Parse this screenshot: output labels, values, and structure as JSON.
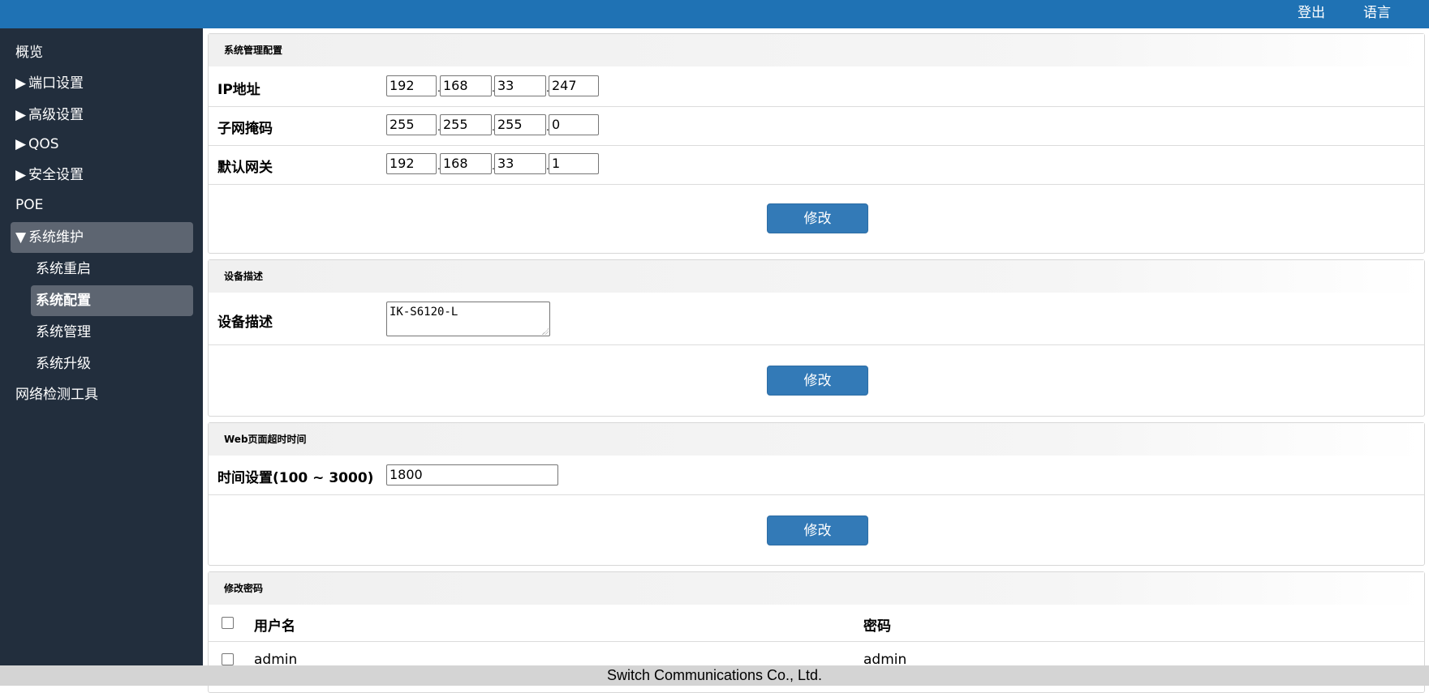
{
  "header": {
    "logout": "登出",
    "language": "语言"
  },
  "sidebar": {
    "overview": "概览",
    "port_settings": "端口设置",
    "advanced_settings": "高级设置",
    "qos": "QOS",
    "security_settings": "安全设置",
    "poe": "POE",
    "system_maintenance": "系统维护",
    "sub": {
      "reboot": "系统重启",
      "config": "系统配置",
      "management": "系统管理",
      "upgrade": "系统升级"
    },
    "network_tools": "网络检测工具",
    "arrow_collapsed": "▶",
    "arrow_expanded": "▼"
  },
  "system_mgmt": {
    "title": "系统管理配置",
    "ip_label": "IP地址",
    "ip": [
      "192",
      "168",
      "33",
      "247"
    ],
    "mask_label": "子网掩码",
    "mask": [
      "255",
      "255",
      "255",
      "0"
    ],
    "gateway_label": "默认网关",
    "gateway": [
      "192",
      "168",
      "33",
      "1"
    ],
    "submit": "修改"
  },
  "device_desc": {
    "title": "设备描述",
    "label": "设备描述",
    "value": "IK-S6120-L",
    "submit": "修改"
  },
  "web_timeout": {
    "title": "Web页面超时时间",
    "label": "时间设置(100 ~ 3000)",
    "value": "1800",
    "submit": "修改"
  },
  "password": {
    "title": "修改密码",
    "col_user": "用户名",
    "col_pass": "密码",
    "rows": [
      {
        "user": "admin",
        "pass": "admin"
      }
    ]
  },
  "footer": {
    "text": "Switch Communications Co., Ltd."
  },
  "colors": {
    "topbar": "#1f72b4",
    "sidebar": "#222e3d",
    "button": "#337ab7",
    "active_nav": "#5d6571"
  }
}
